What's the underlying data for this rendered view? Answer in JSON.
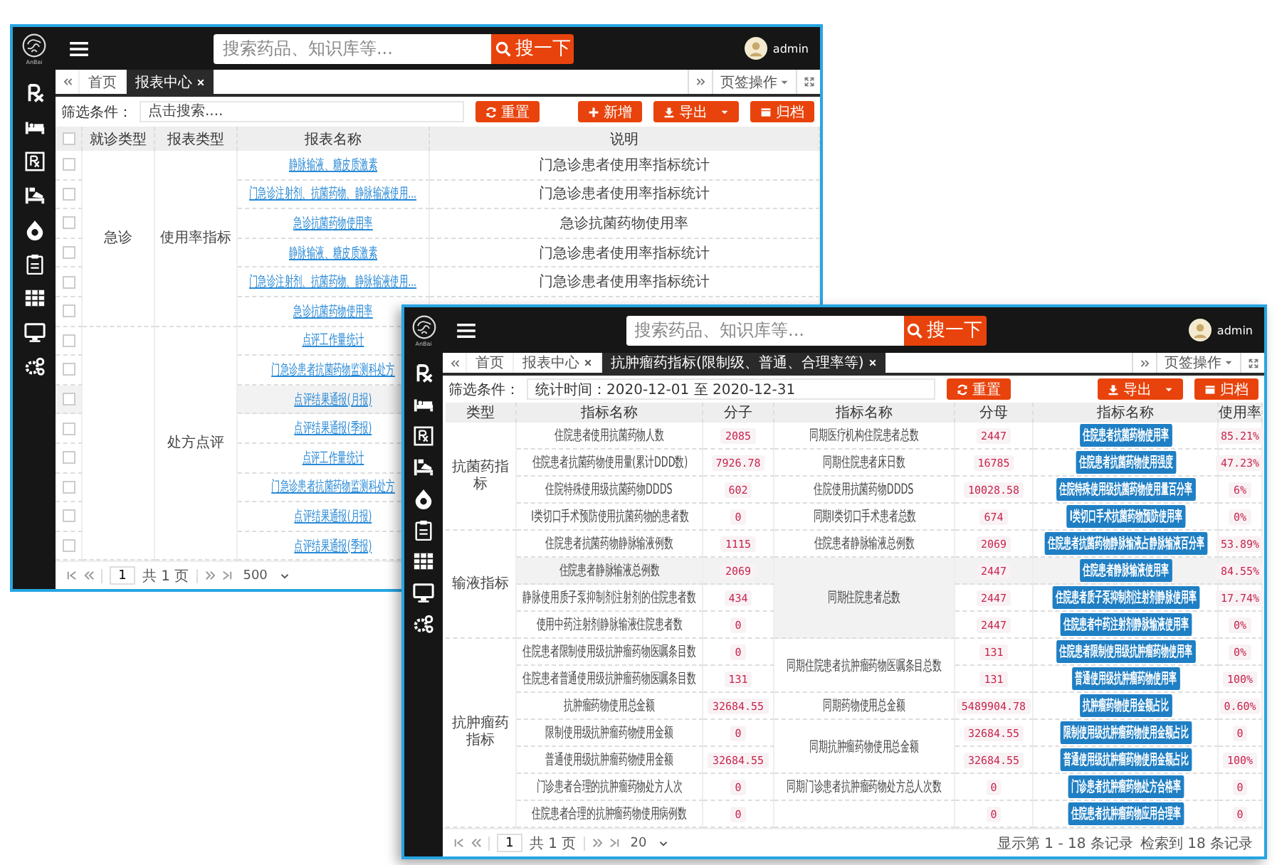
{
  "windows": [
    {
      "kind": "report_list",
      "logo_text": "AnBai",
      "search": {
        "placeholder": "搜索药品、知识库等...",
        "button": "搜一下"
      },
      "user": "admin",
      "tabs": [
        {
          "label": "首页",
          "selected": false,
          "closable": false
        },
        {
          "label": "报表中心",
          "selected": true,
          "closable": true
        }
      ],
      "tab_menu": "页签操作",
      "filter": {
        "label": "筛选条件：",
        "placeholder": "点击搜索...."
      },
      "buttons": [
        {
          "label": "重置",
          "kind": "reset"
        },
        {
          "label": "新增",
          "kind": "add"
        },
        {
          "label": "导出",
          "kind": "export"
        },
        {
          "label": "归档",
          "kind": "archive"
        }
      ],
      "table": {
        "all_checked": false,
        "columns": [
          "就诊类型",
          "报表类型",
          "报表名称",
          "说明"
        ],
        "visit_groups": [
          {
            "visit_type": "急诊",
            "report_groups": [
              {
                "report_type": "使用率指标",
                "reports": [
                  {
                    "name": "静脉输液、糖皮质激素",
                    "description": "门急诊患者使用率指标统计",
                    "checked": false,
                    "hovered": false
                  },
                  {
                    "name": "门急诊注射剂、抗菌药物、静脉输液使用...",
                    "description": "门急诊患者使用率指标统计",
                    "checked": false,
                    "hovered": false
                  },
                  {
                    "name": "急诊抗菌药物使用率",
                    "description": "急诊抗菌药物使用率",
                    "checked": false,
                    "hovered": false
                  },
                  {
                    "name": "静脉输液、糖皮质激素",
                    "description": "门急诊患者使用率指标统计",
                    "checked": false,
                    "hovered": false
                  },
                  {
                    "name": "门急诊注射剂、抗菌药物、静脉输液使用...",
                    "description": "门急诊患者使用率指标统计",
                    "checked": false,
                    "hovered": false
                  },
                  {
                    "name": "急诊抗菌药物使用率",
                    "checked": false,
                    "hovered": false
                  }
                ]
              }
            ]
          },
          {
            "report_groups": [
              {
                "report_type": "处方点评",
                "reports": [
                  {
                    "name": "点评工作量统计",
                    "checked": false,
                    "hovered": false
                  },
                  {
                    "name": "门急诊患者抗菌药物监测科处方",
                    "checked": false,
                    "hovered": false
                  },
                  {
                    "name": "点评结果通报(月报)",
                    "checked": false,
                    "hovered": true
                  },
                  {
                    "name": "点评结果通报(季报)",
                    "checked": false,
                    "hovered": false
                  },
                  {
                    "name": "点评工作量统计",
                    "checked": false,
                    "hovered": false
                  },
                  {
                    "name": "门急诊患者抗菌药物监测科处方",
                    "checked": false,
                    "hovered": false
                  },
                  {
                    "name": "点评结果通报(月报)",
                    "checked": false,
                    "hovered": false
                  },
                  {
                    "name": "点评结果通报(季报)",
                    "checked": false,
                    "hovered": false
                  }
                ]
              }
            ]
          }
        ]
      },
      "pager": {
        "page": "1",
        "pages": "共 1 页",
        "page_size": "500"
      }
    },
    {
      "kind": "indicator_table",
      "logo_text": "AnBai",
      "search": {
        "placeholder": "搜索药品、知识库等...",
        "button": "搜一下"
      },
      "user": "admin",
      "tabs": [
        {
          "label": "首页",
          "selected": false,
          "closable": false
        },
        {
          "label": "报表中心",
          "selected": false,
          "closable": true
        },
        {
          "label": "抗肿瘤药指标(限制级、普通、合理率等)",
          "selected": true,
          "closable": true
        }
      ],
      "tab_menu": "页签操作",
      "filter": {
        "label": "筛选条件：",
        "value": "统计时间：2020-12-01 至 2020-12-31"
      },
      "buttons": [
        {
          "label": "重置",
          "kind": "reset"
        },
        {
          "label": "导出",
          "kind": "export"
        },
        {
          "label": "归档",
          "kind": "archive"
        }
      ],
      "table": {
        "columns": [
          "类型",
          "指标名称",
          "分子",
          "指标名称",
          "分母",
          "指标名称",
          "使用率"
        ],
        "groups": [
          {
            "type": "抗菌药指标",
            "denominators": [
              {
                "name": "同期医疗机构住院患者总数",
                "items": [
                  {
                    "numerator_name": "住院患者使用抗菌药物人数",
                    "numerator": "2085",
                    "denominator": "2447",
                    "indicator": "住院患者抗菌药物使用率",
                    "rate": "85.21%",
                    "hovered": false
                  }
                ]
              },
              {
                "name": "同期住院患者床日数",
                "items": [
                  {
                    "numerator_name": "住院患者抗菌药物使用量(累计DDD数)",
                    "numerator": "7926.78",
                    "denominator": "16785",
                    "indicator": "住院患者抗菌药物使用强度",
                    "rate": "47.23%",
                    "hovered": false
                  }
                ]
              },
              {
                "name": "住院使用抗菌药物DDDS",
                "items": [
                  {
                    "numerator_name": "住院特殊使用级抗菌药物DDDS",
                    "numerator": "602",
                    "denominator": "10028.58",
                    "indicator": "住院特殊使用级抗菌药物使用量百分率",
                    "rate": "6%",
                    "hovered": false
                  }
                ]
              },
              {
                "name": "同期Ⅰ类切口手术患者总数",
                "items": [
                  {
                    "numerator_name": "Ⅰ类切口手术预防使用抗菌药物的患者数",
                    "numerator": "0",
                    "denominator": "674",
                    "indicator": "Ⅰ类切口手术抗菌药物预防使用率",
                    "rate": "0%",
                    "hovered": false
                  }
                ]
              }
            ]
          },
          {
            "type": "输液指标",
            "denominators": [
              {
                "name": "住院患者静脉输液总例数",
                "items": [
                  {
                    "numerator_name": "住院患者抗菌药物静脉输液例数",
                    "numerator": "1115",
                    "denominator": "2069",
                    "indicator": "住院患者抗菌药物静脉输液占静脉输液百分率",
                    "rate": "53.89%",
                    "hovered": false
                  }
                ]
              },
              {
                "name": "同期住院患者总数",
                "items": [
                  {
                    "numerator_name": "住院患者静脉输液总例数",
                    "numerator": "2069",
                    "denominator": "2447",
                    "indicator": "住院患者静脉输液使用率",
                    "rate": "84.55%",
                    "hovered": true
                  },
                  {
                    "numerator_name": "静脉使用质子泵抑制剂注射剂的住院患者数",
                    "numerator": "434",
                    "denominator": "2447",
                    "indicator": "住院患者质子泵抑制剂注射剂静脉使用率",
                    "rate": "17.74%",
                    "hovered": false
                  },
                  {
                    "numerator_name": "使用中药注射剂静脉输液住院患者数",
                    "numerator": "0",
                    "denominator": "2447",
                    "indicator": "住院患者中药注射剂静脉输液使用率",
                    "rate": "0%",
                    "hovered": false
                  }
                ]
              }
            ]
          },
          {
            "type": "抗肿瘤药指标",
            "denominators": [
              {
                "name": "同期住院患者抗肿瘤药物医嘱条目总数",
                "items": [
                  {
                    "numerator_name": "住院患者限制使用级抗肿瘤药物医嘱条目数",
                    "numerator": "0",
                    "denominator": "131",
                    "indicator": "住院患者限制使用级抗肿瘤药物使用率",
                    "rate": "0%",
                    "hovered": false
                  },
                  {
                    "numerator_name": "住院患者普通使用级抗肿瘤药物医嘱条目数",
                    "numerator": "131",
                    "denominator": "131",
                    "indicator": "普通使用级抗肿瘤药物使用率",
                    "rate": "100%",
                    "hovered": false
                  }
                ]
              },
              {
                "name": "同期药物使用总金额",
                "items": [
                  {
                    "numerator_name": "抗肿瘤药物使用总金额",
                    "numerator": "32684.55",
                    "denominator": "5489904.78",
                    "indicator": "抗肿瘤药物使用金额占比",
                    "rate": "0.60%",
                    "hovered": false
                  }
                ]
              },
              {
                "name": "同期抗肿瘤药物使用总金额",
                "items": [
                  {
                    "numerator_name": "限制使用级抗肿瘤药物使用金额",
                    "numerator": "0",
                    "denominator": "32684.55",
                    "indicator": "限制使用级抗肿瘤药物使用金额占比",
                    "rate": "0",
                    "hovered": false
                  },
                  {
                    "numerator_name": "普通使用级抗肿瘤药物使用金额",
                    "numerator": "32684.55",
                    "denominator": "32684.55",
                    "indicator": "普通使用级抗肿瘤药物使用金额占比",
                    "rate": "100%",
                    "hovered": false
                  }
                ]
              },
              {
                "name": "同期门诊患者抗肿瘤药物处方总人次数",
                "items": [
                  {
                    "numerator_name": "门诊患者合理的抗肿瘤药物处方人次",
                    "numerator": "0",
                    "denominator": "0",
                    "indicator": "门诊患者抗肿瘤药物处方合格率",
                    "rate": "0",
                    "hovered": false
                  }
                ]
              },
              {
                "items": [
                  {
                    "numerator_name": "住院患者合理的抗肿瘤药物使用病例数",
                    "numerator": "0",
                    "denominator": "0",
                    "indicator": "住院患者抗肿瘤药物应用合理率",
                    "rate": "0",
                    "hovered": false
                  }
                ]
              }
            ]
          }
        ]
      },
      "pager": {
        "page": "1",
        "pages": "共 1 页",
        "page_size": "20",
        "summary": [
          "显示第 1 - 18 条记录",
          "检索到 18 条记录"
        ]
      }
    }
  ]
}
